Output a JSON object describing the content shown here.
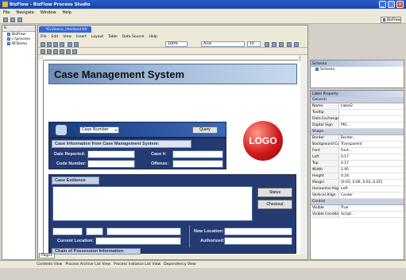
{
  "window": {
    "title": "BizFlow - BizFlow Process Studio",
    "min": "_",
    "max": "□",
    "close": "×"
  },
  "menubar": [
    "File",
    "Navigate",
    "Window",
    "Help"
  ],
  "perspective": {
    "label": "BizFlow"
  },
  "left_panel": {
    "tab": "S",
    "items": [
      "BizFlow",
      "c:\\process",
      "BFDemo"
    ]
  },
  "editor": {
    "tab_label": "*Evidence_checkout.bfr",
    "menu": [
      "File",
      "Edit",
      "View",
      "Insert",
      "Layout",
      "Table",
      "Data Source",
      "Help"
    ],
    "zoom": "100%",
    "font": "Arial",
    "font_size": "10",
    "page_tab": "Page1"
  },
  "form": {
    "title": "Case Management System",
    "search_combo": "Case Number",
    "search_button": "Query",
    "logo_text": "LOGO",
    "section1_title": "Case Information from Case Management System:",
    "date_reported": "Date Reported:",
    "case_num": "Case #:",
    "code_number": "Code Number:",
    "offense": "Offense:",
    "section2_title": "Case Evidence Details:",
    "status_button": "Status",
    "checkout_button": "Checkout",
    "current_location": "Current Location:",
    "new_location": "New Location:",
    "authorized": "Authorized:",
    "section3_title": "Chain of Possession Information:"
  },
  "schema_panel": {
    "title": "Schema",
    "item": "Schema"
  },
  "properties": {
    "title": "Label Property",
    "groups": [
      {
        "name": "General",
        "rows": [
          [
            "Name",
            "Label2"
          ],
          [
            "Tooltip",
            ""
          ],
          [
            "Data Exchange",
            ""
          ],
          [
            "Digital Sign",
            "PKI..."
          ]
        ]
      },
      {
        "name": "Shape",
        "rows": [
          [
            "Border",
            "Border..."
          ],
          [
            "Background Co",
            "Transparent"
          ],
          [
            "Font",
            "Font..."
          ],
          [
            "Left",
            "0.17"
          ],
          [
            "Top",
            "0.17"
          ],
          [
            "Width",
            "2.95"
          ],
          [
            "Height",
            "0.24"
          ],
          [
            "Margin",
            "[0.03, 0.06, 0.03, 0.05]"
          ],
          [
            "Horizontal Align",
            "Left"
          ],
          [
            "Vertical Align",
            "Center"
          ]
        ]
      },
      {
        "name": "Control",
        "rows": [
          [
            "Visible",
            "True"
          ],
          [
            "Visible Condition",
            "Script..."
          ]
        ]
      }
    ]
  },
  "bottom_tabs": [
    "Contents View",
    "Process Archive List View",
    "Process Instance List View",
    "Dependency View"
  ]
}
